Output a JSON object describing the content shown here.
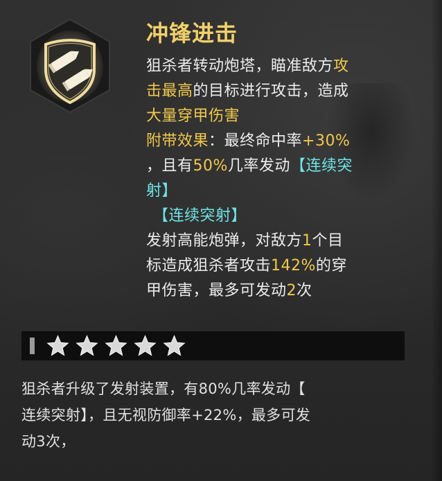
{
  "skill": {
    "icon": "twin-shells-shield-icon",
    "title": "冲锋进击",
    "description": {
      "l1_a": "狙杀者转动炮塔，瞄准敌方",
      "l1_b": "攻",
      "l2_a": "击最高",
      "l2_b": "的目标进行攻击，造成",
      "l3": "大量穿甲伤害",
      "l4_a": "附带效果",
      "l4_b": "：最终命中率",
      "l4_c": "+30%",
      "l5_a": "，且有",
      "l5_b": "50%",
      "l5_c": "几率发动",
      "l5_d": "【连续突",
      "l6": "射】"
    },
    "subskill": {
      "name": "【连续突射】",
      "l1_a": "发射高能炮弹，对敌方",
      "l1_b": "1",
      "l1_c": "个目",
      "l2_a": "标造成狙杀者攻击",
      "l2_b": "142%",
      "l2_c": "的穿",
      "l3_a": "甲伤害，最多可发动",
      "l3_b": "2",
      "l3_c": "次"
    }
  },
  "star_level": {
    "stars": 5,
    "max": 5,
    "icon": "star-icon"
  },
  "upgrade": {
    "line1": "狙杀者升级了发射装置，有80%几率发动【",
    "line2": "连续突射】，且无视防御率+22%，最多可发",
    "line3": "动3次，"
  },
  "colors": {
    "title": "#f2d16b",
    "highlight_gold": "#f2c94c",
    "highlight_cyan": "#6fe3e6",
    "text": "#ececec",
    "background": "#2b2b2b",
    "star_bar": "#0e0e0e"
  }
}
